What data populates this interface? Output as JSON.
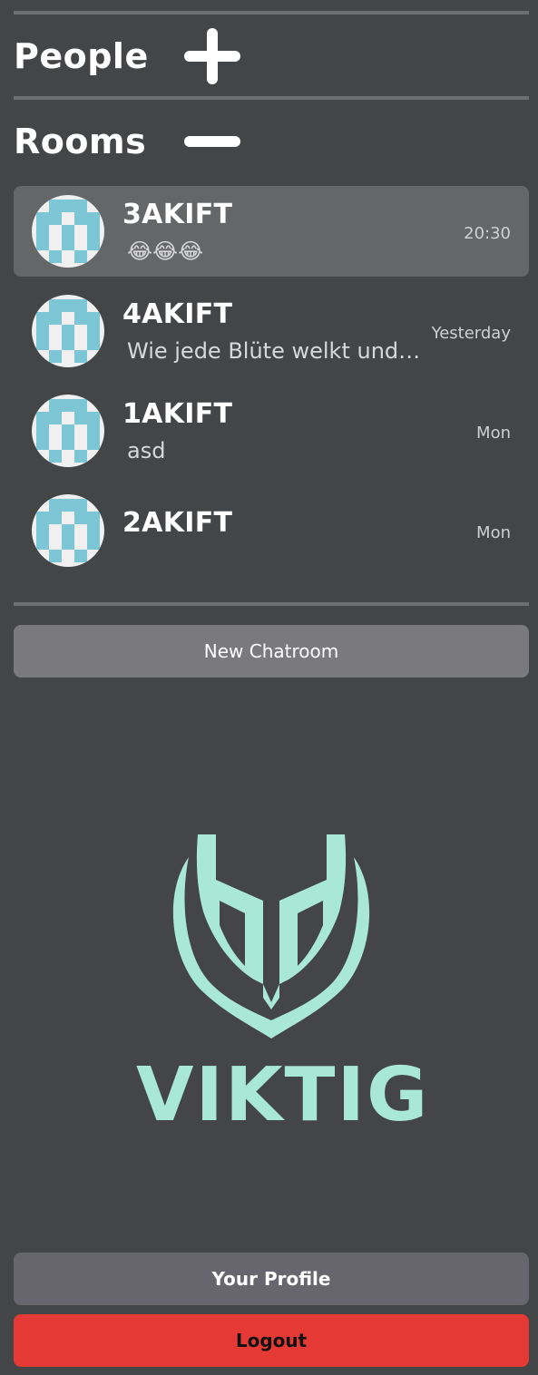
{
  "sections": {
    "people": {
      "title": "People",
      "toggle_icon": "plus-icon",
      "expanded": false
    },
    "rooms": {
      "title": "Rooms",
      "toggle_icon": "minus-icon",
      "expanded": true
    }
  },
  "rooms": [
    {
      "name": "3AKIFT",
      "preview": "😂😂😂",
      "time": "20:30",
      "active": true,
      "avatar_icon": "identicon-avatar"
    },
    {
      "name": "4AKIFT",
      "preview": "Wie jede Blüte welkt und jede Jugend",
      "time": "Yesterday",
      "active": false,
      "avatar_icon": "identicon-avatar"
    },
    {
      "name": "1AKIFT",
      "preview": "asd",
      "time": "Mon",
      "active": false,
      "avatar_icon": "identicon-avatar"
    },
    {
      "name": "2AKIFT",
      "preview": "",
      "time": "Mon",
      "active": false,
      "avatar_icon": "identicon-avatar"
    }
  ],
  "buttons": {
    "new_chatroom": "New Chatroom",
    "profile": "Your Profile",
    "logout": "Logout"
  },
  "brand": {
    "name": "VIKTIG",
    "color": "#a8e8d5"
  },
  "colors": {
    "background": "#444547",
    "active_room": "#656668",
    "logout": "#e53935",
    "avatar_pattern": "#7cc6d6"
  }
}
